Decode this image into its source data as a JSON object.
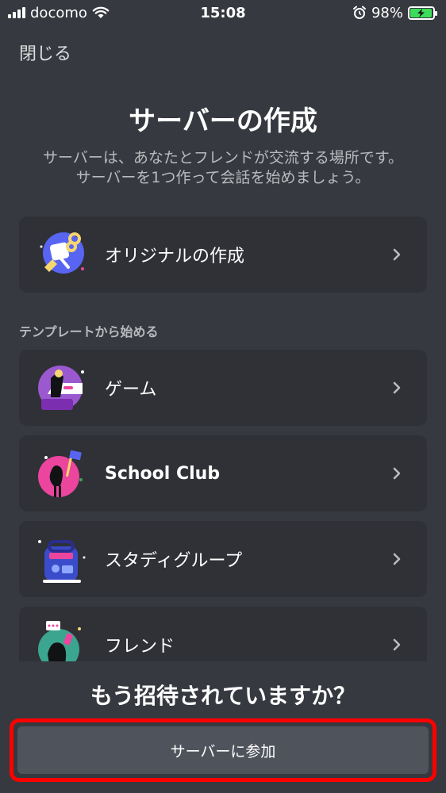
{
  "status_bar": {
    "carrier": "docomo",
    "time": "15:08",
    "battery_percent": "98%",
    "battery_level": 0.98,
    "icons": [
      "signal-icon",
      "wifi-icon",
      "alarm-icon",
      "battery-charging-icon"
    ]
  },
  "header": {
    "close_label": "閉じる",
    "title": "サーバーの作成",
    "subtitle_line1": "サーバーは、あなたとフレンドが交流する場所です。",
    "subtitle_line2": "サーバーを1つ作って会話を始めましょう。"
  },
  "create_original": {
    "label": "オリジナルの作成",
    "icon": "create-own-server-illustration"
  },
  "templates": {
    "heading": "テンプレートから始める",
    "items": [
      {
        "label": "ゲーム",
        "icon": "gaming-template-illustration"
      },
      {
        "label": "School Club",
        "icon": "school-club-template-illustration"
      },
      {
        "label": "スタディグループ",
        "icon": "study-group-template-illustration"
      },
      {
        "label": "フレンド",
        "icon": "friends-template-illustration"
      }
    ]
  },
  "footer": {
    "question": "もう招待されていますか？",
    "join_label": "サーバーに参加"
  },
  "colors": {
    "background": "#36393f",
    "card": "#2f3136",
    "button": "#4f545c",
    "highlight": "#ff0000",
    "muted_text": "#b9bbbe"
  }
}
